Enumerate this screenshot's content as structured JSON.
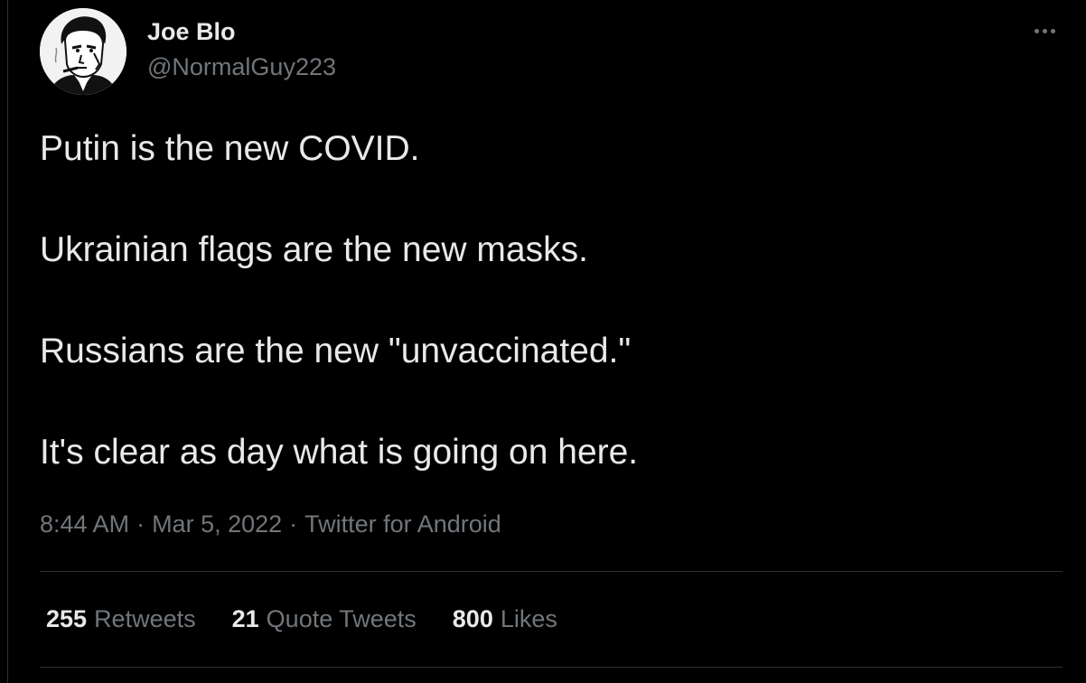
{
  "user": {
    "display_name": "Joe Blo",
    "handle": "@NormalGuy223",
    "avatar_icon": "illustrated-man-smoking-portrait"
  },
  "tweet": {
    "lines": [
      "Putin is the new COVID.",
      "Ukrainian flags are the new masks.",
      "Russians are the new \"unvaccinated.\"",
      "It's clear as day what is going on here."
    ]
  },
  "meta": {
    "time": "8:44 AM",
    "separator": "·",
    "date": "Mar 5, 2022",
    "source": "Twitter for Android"
  },
  "stats": {
    "retweets_count": "255",
    "retweets_label": "Retweets",
    "quotes_count": "21",
    "quotes_label": "Quote Tweets",
    "likes_count": "800",
    "likes_label": "Likes"
  },
  "more_icon": "more-horizontal-dots",
  "colors": {
    "background": "#000000",
    "primary_text": "#e7e9ea",
    "secondary_text": "#71767b",
    "divider": "#2f3336"
  }
}
